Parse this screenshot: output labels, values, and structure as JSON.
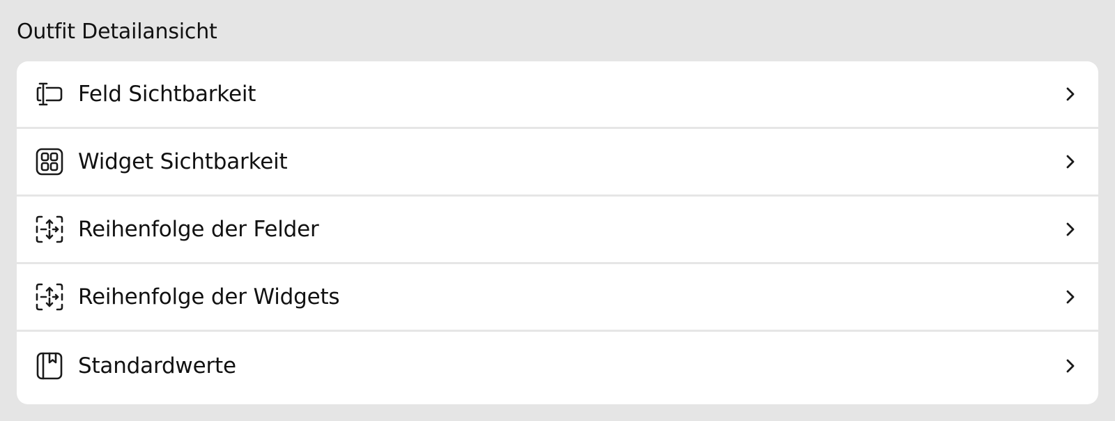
{
  "section": {
    "title": "Outfit Detailansicht"
  },
  "rows": [
    {
      "label": "Feld Sichtbarkeit",
      "icon": "text-field-cursor-icon"
    },
    {
      "label": "Widget Sichtbarkeit",
      "icon": "widget-grid-icon"
    },
    {
      "label": "Reihenfolge der Felder",
      "icon": "reorder-arrows-icon"
    },
    {
      "label": "Reihenfolge der Widgets",
      "icon": "reorder-arrows-icon"
    },
    {
      "label": "Standardwerte",
      "icon": "bookmark-book-icon"
    }
  ],
  "colors": {
    "background": "#e5e5e5",
    "card": "#ffffff",
    "separator": "#e6e6e6",
    "text": "#111111"
  }
}
